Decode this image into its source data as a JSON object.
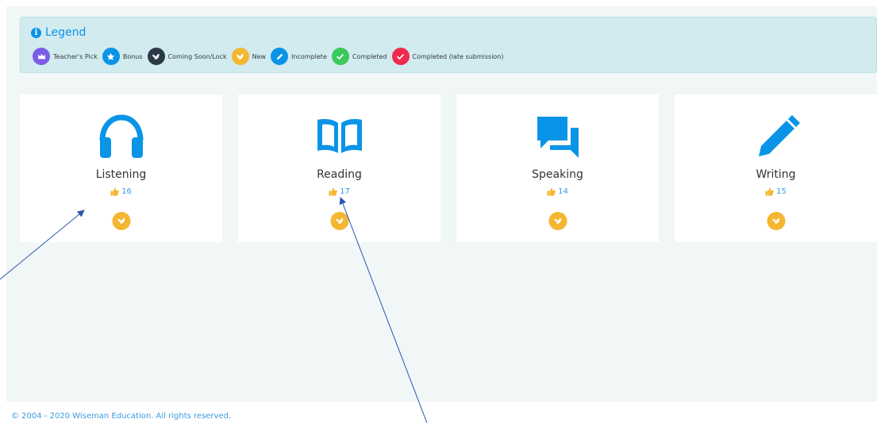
{
  "legend": {
    "title": "Legend",
    "items": [
      {
        "label": "Teacher's Pick",
        "color": "#7b5ce6",
        "icon": "crown-icon"
      },
      {
        "label": "Bonus",
        "color": "#0a94e8",
        "icon": "star-icon"
      },
      {
        "label": "Coming Soon/Lock",
        "color": "#2c3a47",
        "icon": "bird-icon"
      },
      {
        "label": "New",
        "color": "#f5b731",
        "icon": "bird-icon"
      },
      {
        "label": "Incomplete",
        "color": "#0a94e8",
        "icon": "pencil-icon"
      },
      {
        "label": "Completed",
        "color": "#3cc85b",
        "icon": "check-icon"
      },
      {
        "label": "Completed (late submission)",
        "color": "#ef2a4f",
        "icon": "check-icon"
      }
    ]
  },
  "skills": [
    {
      "title": "Listening",
      "likes": "16",
      "icon": "headphones-icon",
      "status": "New"
    },
    {
      "title": "Reading",
      "likes": "17",
      "icon": "book-icon",
      "status": "New"
    },
    {
      "title": "Speaking",
      "likes": "14",
      "icon": "speech-bubbles-icon",
      "status": "New"
    },
    {
      "title": "Writing",
      "likes": "15",
      "icon": "pencil-icon",
      "status": "New"
    }
  ],
  "footer": {
    "text": "© 2004 - 2020 Wiseman Education. All rights reserved."
  },
  "colors": {
    "accent": "#0a94e8",
    "legend_bg": "#d1ebef",
    "page_bg": "#f1f6f7",
    "new_badge": "#f5b731",
    "thumb": "#f5b731",
    "annotation_arrow": "#2a56b0"
  }
}
